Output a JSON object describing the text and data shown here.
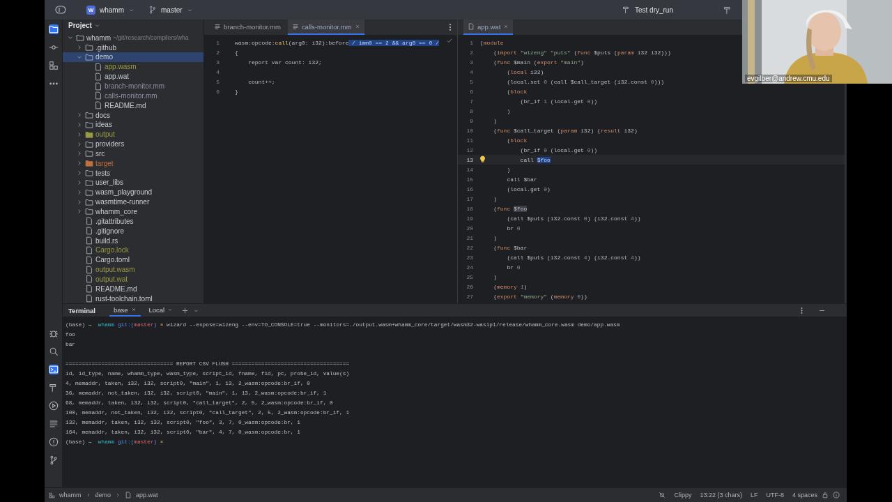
{
  "title_bar": {
    "project_badge": "W",
    "project": "whamm",
    "branch": "master",
    "run_config": "Test dry_run"
  },
  "tool_strip": {
    "top": [
      {
        "selected": true
      },
      {
        "selected": false
      },
      {
        "selected": false
      },
      {
        "selected": false
      }
    ],
    "bottom": [
      {
        "selected": false
      },
      {
        "selected": false
      },
      {
        "selected": true
      },
      {
        "selected": false
      },
      {
        "selected": false
      },
      {
        "selected": false
      },
      {
        "selected": false
      },
      {
        "selected": false
      }
    ]
  },
  "project_panel": {
    "title": "Project",
    "tree": [
      {
        "name": "whamm",
        "path": "~/git/research/compilers/wha",
        "kind": "folder",
        "expanded": true,
        "selected": false,
        "children": [
          {
            "name": ".github",
            "kind": "folder",
            "expanded": false,
            "selected": false
          },
          {
            "name": "demo",
            "kind": "folder",
            "expanded": true,
            "selected": true,
            "children": [
              {
                "name": "app.wasm",
                "kind": "file",
                "selected": false,
                "color": "#9a9a45"
              },
              {
                "name": "app.wat",
                "kind": "file",
                "selected": false
              },
              {
                "name": "branch-monitor.mm",
                "kind": "file",
                "selected": false,
                "color": "#8b90a6"
              },
              {
                "name": "calls-monitor.mm",
                "kind": "file",
                "selected": false,
                "color": "#8b90a6"
              },
              {
                "name": "README.md",
                "kind": "file",
                "selected": false
              }
            ]
          },
          {
            "name": "docs",
            "kind": "folder",
            "expanded": false,
            "selected": false
          },
          {
            "name": "ideas",
            "kind": "folder",
            "expanded": false,
            "selected": false
          },
          {
            "name": "output",
            "kind": "folder",
            "expanded": false,
            "selected": false,
            "color": "#9a9a45"
          },
          {
            "name": "providers",
            "kind": "folder",
            "expanded": false,
            "selected": false
          },
          {
            "name": "src",
            "kind": "folder",
            "expanded": false,
            "selected": false
          },
          {
            "name": "target",
            "kind": "folder",
            "expanded": false,
            "selected": false,
            "color": "#c2703f"
          },
          {
            "name": "tests",
            "kind": "folder",
            "expanded": false,
            "selected": false
          },
          {
            "name": "user_libs",
            "kind": "folder",
            "expanded": false,
            "selected": false
          },
          {
            "name": "wasm_playground",
            "kind": "folder",
            "expanded": false,
            "selected": false
          },
          {
            "name": "wasmtime-runner",
            "kind": "folder",
            "expanded": false,
            "selected": false
          },
          {
            "name": "whamm_core",
            "kind": "folder",
            "expanded": false,
            "selected": false
          },
          {
            "name": ".gitattributes",
            "kind": "file",
            "selected": false
          },
          {
            "name": ".gitignore",
            "kind": "file",
            "selected": false
          },
          {
            "name": "build.rs",
            "kind": "file",
            "selected": false
          },
          {
            "name": "Cargo.lock",
            "kind": "file",
            "selected": false,
            "color": "#9a9a45"
          },
          {
            "name": "Cargo.toml",
            "kind": "file",
            "selected": false
          },
          {
            "name": "output.wasm",
            "kind": "file",
            "selected": false,
            "color": "#9a9a45"
          },
          {
            "name": "output.wat",
            "kind": "file",
            "selected": false,
            "color": "#9a9a45"
          },
          {
            "name": "README.md",
            "kind": "file",
            "selected": false
          },
          {
            "name": "rust-toolchain.toml",
            "kind": "file",
            "selected": false
          }
        ]
      }
    ]
  },
  "editors": [
    {
      "tabs": [
        {
          "label": "branch-monitor.mm",
          "selected": false
        },
        {
          "label": "calls-monitor.mm",
          "selected": true
        }
      ],
      "lines": [
        {
          "no": "1",
          "current": false,
          "segments": [
            {
              "kind": "plain",
              "text": "wasm:opcode:"
            },
            {
              "kind": "fn",
              "text": "call"
            },
            {
              "kind": "plain",
              "text": "(arg0: i32):before"
            },
            {
              "kind": "selection",
              "text": " / imm0 == 2 && arg0 == 0 /"
            }
          ]
        },
        {
          "no": "2",
          "current": false,
          "segments": [
            {
              "kind": "plain",
              "text": "{"
            }
          ]
        },
        {
          "no": "3",
          "current": false,
          "segments": [
            {
              "kind": "plain",
              "text": "    report var count: i32;"
            }
          ]
        },
        {
          "no": "4",
          "current": false
        },
        {
          "no": "5",
          "current": false,
          "segments": [
            {
              "kind": "plain",
              "text": "    count++;"
            }
          ]
        },
        {
          "no": "6",
          "current": false,
          "segments": [
            {
              "kind": "plain",
              "text": "}"
            }
          ]
        }
      ]
    },
    {
      "tabs": [
        {
          "label": "app.wat",
          "selected": true
        }
      ],
      "lines": [
        {
          "no": "1",
          "current": false,
          "segments": [
            {
              "kind": "plain",
              "text": "("
            },
            {
              "kind": "kw",
              "text": "module"
            }
          ]
        },
        {
          "no": "2",
          "current": false,
          "segments": [
            {
              "kind": "plain",
              "text": "    ("
            },
            {
              "kind": "kw",
              "text": "import"
            },
            {
              "kind": "str",
              "text": " \"wizeng\""
            },
            {
              "kind": "str",
              "text": " \"puts\""
            },
            {
              "kind": "plain",
              "text": " ("
            },
            {
              "kind": "kw",
              "text": "func"
            },
            {
              "kind": "plain",
              "text": " $puts ("
            },
            {
              "kind": "kw",
              "text": "param"
            },
            {
              "kind": "plain",
              "text": " i32 i32)))"
            }
          ]
        },
        {
          "no": "3",
          "current": false,
          "segments": [
            {
              "kind": "plain",
              "text": "    ("
            },
            {
              "kind": "kw",
              "text": "func"
            },
            {
              "kind": "plain",
              "text": " $main ("
            },
            {
              "kind": "kw",
              "text": "export"
            },
            {
              "kind": "str",
              "text": " \"main\""
            },
            {
              "kind": "plain",
              "text": ")"
            }
          ]
        },
        {
          "no": "4",
          "current": false,
          "segments": [
            {
              "kind": "plain",
              "text": "        ("
            },
            {
              "kind": "kw",
              "text": "local"
            },
            {
              "kind": "plain",
              "text": " i32)"
            }
          ]
        },
        {
          "no": "5",
          "current": false,
          "segments": [
            {
              "kind": "plain",
              "text": "        (local.set "
            },
            {
              "kind": "num",
              "text": "0"
            },
            {
              "kind": "plain",
              "text": " (call $call_target (i32.const "
            },
            {
              "kind": "num",
              "text": "0"
            },
            {
              "kind": "plain",
              "text": ")))"
            }
          ]
        },
        {
          "no": "6",
          "current": false,
          "segments": [
            {
              "kind": "plain",
              "text": "        ("
            },
            {
              "kind": "kw",
              "text": "block"
            }
          ]
        },
        {
          "no": "7",
          "current": false,
          "segments": [
            {
              "kind": "plain",
              "text": "            (br_if "
            },
            {
              "kind": "num",
              "text": "1"
            },
            {
              "kind": "plain",
              "text": " (local.get "
            },
            {
              "kind": "num",
              "text": "0"
            },
            {
              "kind": "plain",
              "text": "))"
            }
          ]
        },
        {
          "no": "8",
          "current": false,
          "segments": [
            {
              "kind": "plain",
              "text": "        )"
            }
          ]
        },
        {
          "no": "9",
          "current": false,
          "segments": [
            {
              "kind": "plain",
              "text": "    )"
            }
          ]
        },
        {
          "no": "10",
          "current": false,
          "segments": [
            {
              "kind": "plain",
              "text": "    ("
            },
            {
              "kind": "kw",
              "text": "func"
            },
            {
              "kind": "plain",
              "text": " $call_target ("
            },
            {
              "kind": "kw",
              "text": "param"
            },
            {
              "kind": "plain",
              "text": " i32) ("
            },
            {
              "kind": "kw",
              "text": "result"
            },
            {
              "kind": "plain",
              "text": " i32)"
            }
          ]
        },
        {
          "no": "11",
          "current": false,
          "segments": [
            {
              "kind": "plain",
              "text": "        ("
            },
            {
              "kind": "kw",
              "text": "block"
            }
          ]
        },
        {
          "no": "12",
          "current": false,
          "segments": [
            {
              "kind": "plain",
              "text": "            (br_if "
            },
            {
              "kind": "num",
              "text": "0"
            },
            {
              "kind": "plain",
              "text": " (local.get "
            },
            {
              "kind": "num",
              "text": "0"
            },
            {
              "kind": "plain",
              "text": "))"
            }
          ]
        },
        {
          "no": "13",
          "current": true,
          "segments": [
            {
              "kind": "plain",
              "text": "            call "
            },
            {
              "kind": "selection",
              "text": "$foo"
            }
          ]
        },
        {
          "no": "14",
          "current": false,
          "segments": [
            {
              "kind": "plain",
              "text": "        )"
            }
          ]
        },
        {
          "no": "15",
          "current": false,
          "segments": [
            {
              "kind": "plain",
              "text": "        call $bar"
            }
          ]
        },
        {
          "no": "16",
          "current": false,
          "segments": [
            {
              "kind": "plain",
              "text": "        (local.get "
            },
            {
              "kind": "num",
              "text": "0"
            },
            {
              "kind": "plain",
              "text": ")"
            }
          ]
        },
        {
          "no": "17",
          "current": false,
          "segments": [
            {
              "kind": "plain",
              "text": "    )"
            }
          ]
        },
        {
          "no": "18",
          "current": false,
          "segments": [
            {
              "kind": "plain",
              "text": "    ("
            },
            {
              "kind": "kw",
              "text": "func "
            },
            {
              "kind": "match",
              "text": "$foo"
            }
          ]
        },
        {
          "no": "19",
          "current": false,
          "segments": [
            {
              "kind": "plain",
              "text": "        (call $puts (i32.const "
            },
            {
              "kind": "num",
              "text": "0"
            },
            {
              "kind": "plain",
              "text": ") (i32.const "
            },
            {
              "kind": "num",
              "text": "4"
            },
            {
              "kind": "plain",
              "text": "))"
            }
          ]
        },
        {
          "no": "20",
          "current": false,
          "segments": [
            {
              "kind": "plain",
              "text": "        br "
            },
            {
              "kind": "num",
              "text": "0"
            }
          ]
        },
        {
          "no": "21",
          "current": false,
          "segments": [
            {
              "kind": "plain",
              "text": "    )"
            }
          ]
        },
        {
          "no": "22",
          "current": false,
          "segments": [
            {
              "kind": "plain",
              "text": "    ("
            },
            {
              "kind": "kw",
              "text": "func"
            },
            {
              "kind": "plain",
              "text": " $bar"
            }
          ]
        },
        {
          "no": "23",
          "current": false,
          "segments": [
            {
              "kind": "plain",
              "text": "        (call $puts (i32.const "
            },
            {
              "kind": "num",
              "text": "4"
            },
            {
              "kind": "plain",
              "text": ") (i32.const "
            },
            {
              "kind": "num",
              "text": "4"
            },
            {
              "kind": "plain",
              "text": "))"
            }
          ]
        },
        {
          "no": "24",
          "current": false,
          "segments": [
            {
              "kind": "plain",
              "text": "        br "
            },
            {
              "kind": "num",
              "text": "0"
            }
          ]
        },
        {
          "no": "25",
          "current": false,
          "segments": [
            {
              "kind": "plain",
              "text": "    )"
            }
          ]
        },
        {
          "no": "26",
          "current": false,
          "segments": [
            {
              "kind": "plain",
              "text": "    ("
            },
            {
              "kind": "kw",
              "text": "memory "
            },
            {
              "kind": "num",
              "text": "1"
            },
            {
              "kind": "plain",
              "text": ")"
            }
          ]
        },
        {
          "no": "27",
          "current": false,
          "segments": [
            {
              "kind": "plain",
              "text": "    ("
            },
            {
              "kind": "kw",
              "text": "export"
            },
            {
              "kind": "str",
              "text": " \"memory\""
            },
            {
              "kind": "plain",
              "text": " ("
            },
            {
              "kind": "kw",
              "text": "memory "
            },
            {
              "kind": "num",
              "text": "0"
            },
            {
              "kind": "plain",
              "text": "))"
            }
          ]
        }
      ]
    }
  ],
  "terminal": {
    "title": "Terminal",
    "tabs": [
      {
        "label": "base",
        "selected": true
      },
      {
        "label": "Local",
        "selected": false
      }
    ],
    "lines": [
      {
        "segments": [
          {
            "kind": "plain",
            "text": "(base) "
          },
          {
            "kind": "arrow",
            "text": "→"
          },
          {
            "kind": "dir",
            "text": "  whamm"
          },
          {
            "kind": "git",
            "text": " git:("
          },
          {
            "kind": "branch",
            "text": "master"
          },
          {
            "kind": "git",
            "text": ")"
          },
          {
            "kind": "dirty",
            "text": " ×"
          },
          {
            "kind": "plain",
            "text": " wizard --expose=wizeng --env=TO_CONSOLE=true --monitors=./output.wasm+whamm_core/target/wasm32-wasip1/release/whamm_core.wasm demo/app.wasm"
          }
        ]
      },
      {
        "segments": [
          {
            "kind": "plain",
            "text": "foo"
          }
        ]
      },
      {
        "segments": [
          {
            "kind": "plain",
            "text": "bar"
          }
        ]
      },
      {
        "blank_before": true,
        "segments": [
          {
            "kind": "plain",
            "text": "================================= REPORT CSV FLUSH ===================================="
          }
        ]
      },
      {
        "segments": [
          {
            "kind": "plain",
            "text": "id, id_type, name, whamm_type, wasm_type, script_id, fname, fid, pc, probe_id, value(s)"
          }
        ]
      },
      {
        "segments": [
          {
            "kind": "plain",
            "text": "4, memaddr, taken, i32, i32, script0, \"main\", 1, 13, 2_wasm:opcode:br_if, 0"
          }
        ]
      },
      {
        "segments": [
          {
            "kind": "plain",
            "text": "36, memaddr, not_taken, i32, i32, script0, \"main\", 1, 13, 2_wasm:opcode:br_if, 1"
          }
        ]
      },
      {
        "segments": [
          {
            "kind": "plain",
            "text": "68, memaddr, taken, i32, i32, script0, \"call_target\", 2, 5, 2_wasm:opcode:br_if, 0"
          }
        ]
      },
      {
        "segments": [
          {
            "kind": "plain",
            "text": "100, memaddr, not_taken, i32, i32, script0, \"call_target\", 2, 5, 2_wasm:opcode:br_if, 1"
          }
        ]
      },
      {
        "segments": [
          {
            "kind": "plain",
            "text": "132, memaddr, taken, i32, i32, script0, \"foo\", 3, 7, 0_wasm:opcode:br, 1"
          }
        ]
      },
      {
        "segments": [
          {
            "kind": "plain",
            "text": "164, memaddr, taken, i32, i32, script0, \"bar\", 4, 7, 0_wasm:opcode:br, 1"
          }
        ]
      },
      {
        "segments": [
          {
            "kind": "plain",
            "text": "(base) "
          },
          {
            "kind": "arrow",
            "text": "→"
          },
          {
            "kind": "dir",
            "text": "  whamm"
          },
          {
            "kind": "git",
            "text": " git:("
          },
          {
            "kind": "branch",
            "text": "master"
          },
          {
            "kind": "git",
            "text": ")"
          },
          {
            "kind": "dirty",
            "text": " ×"
          }
        ]
      }
    ]
  },
  "status_bar": {
    "breadcrumbs": [
      "whamm",
      "demo",
      "app.wat"
    ],
    "linter": "Clippy",
    "position": "13:22 (3 chars)",
    "line_separator": "LF",
    "encoding": "UTF-8",
    "indent": "4 spaces"
  },
  "video": {
    "name_label": "evgilber@andrew.cmu.edu"
  }
}
